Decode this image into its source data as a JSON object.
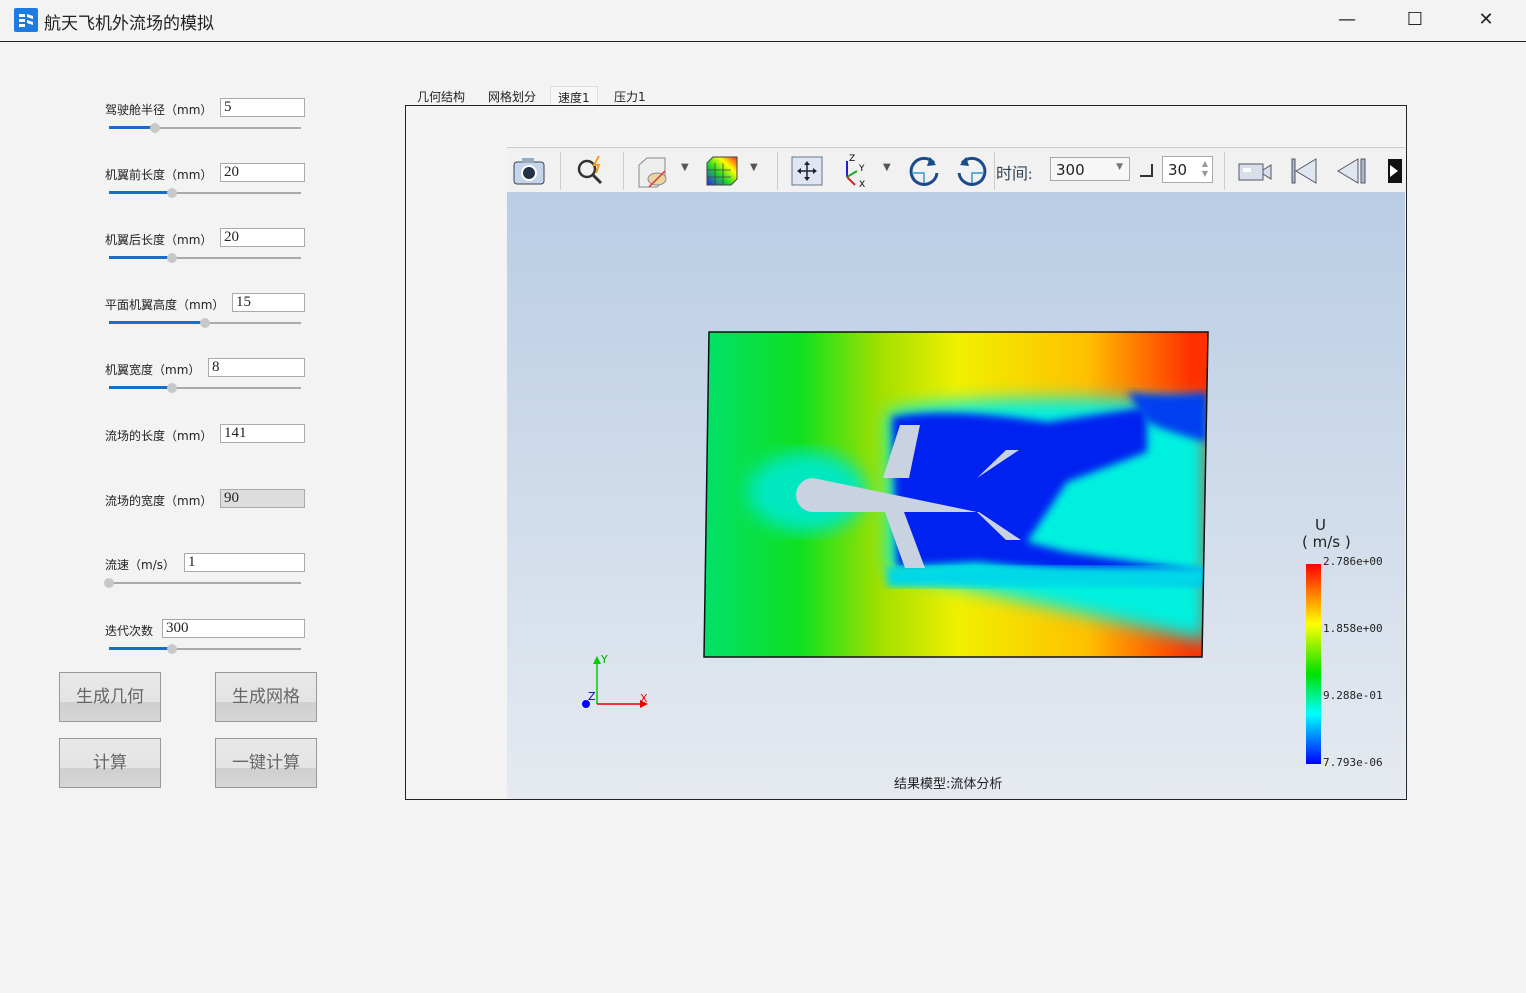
{
  "window": {
    "title": "航天飞机外流场的模拟",
    "minimize": "—",
    "maximize": "☐",
    "close": "✕"
  },
  "params": [
    {
      "label": "驾驶舱半径（mm）",
      "value": "5",
      "slider": 0.24
    },
    {
      "label": "机翼前长度（mm）",
      "value": "20",
      "slider": 0.33
    },
    {
      "label": "机翼后长度（mm）",
      "value": "20",
      "slider": 0.33
    },
    {
      "label": "平面机翼高度（mm）",
      "value": "15",
      "slider": 0.5
    },
    {
      "label": "机翼宽度（mm）",
      "value": "8",
      "slider": 0.33
    },
    {
      "label": "流场的长度（mm）",
      "value": "141"
    },
    {
      "label": "流场的宽度（mm）",
      "value": "90",
      "disabled": true
    },
    {
      "label": "流速（m/s）",
      "value": "1",
      "slider": 0.0
    },
    {
      "label": "迭代次数",
      "value": "300",
      "slider": 0.33
    }
  ],
  "buttons": {
    "gen_geom": "生成几何",
    "gen_mesh": "生成网格",
    "compute": "计算",
    "one_click": "一键计算"
  },
  "tabs": [
    {
      "label": "几何结构"
    },
    {
      "label": "网格划分"
    },
    {
      "label": "速度1",
      "active": true
    },
    {
      "label": "压力1"
    }
  ],
  "toolbar": {
    "time_label": "时间:",
    "time_value": "300",
    "step_value": "30"
  },
  "viewer": {
    "caption": "结果模型:流体分析",
    "axes": {
      "x": "X",
      "y": "Y",
      "z": "Z"
    }
  },
  "legend": {
    "title": "U",
    "unit": "( m/s )",
    "ticks": [
      "2.786e+00",
      "1.858e+00",
      "9.288e-01",
      "7.793e-06"
    ]
  },
  "colors": {
    "accent": "#1a6dc4",
    "max": "#ff0000",
    "min": "#0000ff"
  }
}
